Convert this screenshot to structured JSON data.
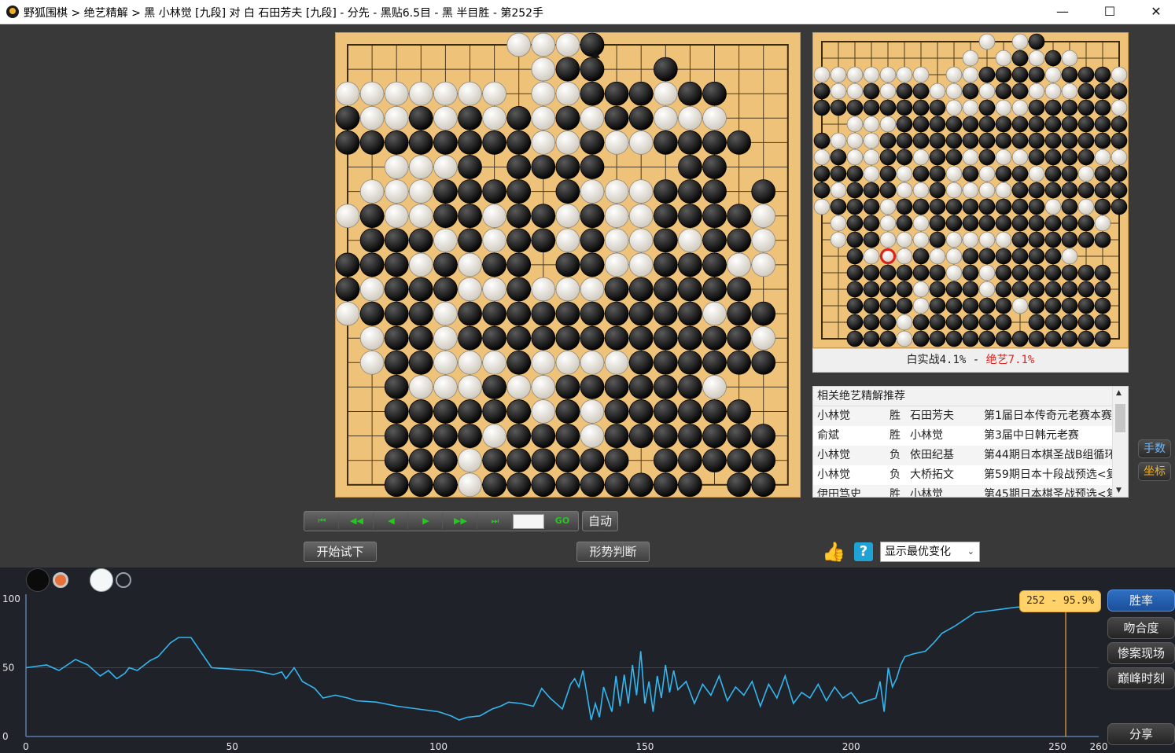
{
  "window": {
    "title": "野狐围棋 > 绝艺精解 > 黑 小林觉 [九段] 对 白 石田芳夫 [九段] - 分先 - 黑贴6.5目 - 黑 半目胜 - 第252手",
    "minimize": "—",
    "maximize": "☐",
    "close": "✕"
  },
  "board": {
    "size": 19,
    "rows": [
      ".......wwwb........",
      "........wbb..b.....",
      "wwwwwww.wwbbbwbb...",
      "bwwbwbwbwbwbbwww...",
      "bbbbbbbbwwbwwbbbb..",
      "..wwwb.bbbb...bb...",
      ".wwwbbbb.bwwwbbb.b.",
      "wbwwbbwbbwbwwbbbbw.",
      ".bbbwbwbbwbwwbwbbw.",
      "bbbwbwbb.bbwwbbbww.",
      "bwbbbwwbwwwbbbbbb..",
      "wbbbwbbbbbbbbbbwbb.",
      ".wbbwbbbbbbbbbbbbw.",
      ".wbbwwwbwwwwbbbbbb.",
      "..bwwwbwwbbbbbbw...",
      "..bbbbbbwbwbbbbbb..",
      "..bbbbwbbbwbbbbbbb.",
      "..bbbwbbbbbb.bbbbb.",
      "..bbbwbbbbbbbbb.bb."
    ],
    "last_move_marker": "▲"
  },
  "mini_board": {
    "rows": [
      "..........w.wb.....",
      ".........w.wbwbw...",
      "wwwwwww.wwbbbbwbbbw",
      "bwwbwbbwwbwbbwwwbbb",
      "bbbbbbbbwwbwwbbbbbw",
      "..wwwbbbbbbbbbbbbbb",
      "bwwwbbbbbbbbbbbbbbb",
      "wbwwbbwbbwbwwbbbbww",
      "bbbwbwbbwbwbbwbbwbb",
      "bwbbbwwbwwwwbbbbbbb",
      "wbbbwbbbbbbbbbwbwbb",
      ".wbbwbwbbbbbbbbbbw.",
      ".wbbwwwbwwwwbbbbbb.",
      "..bwwwbwwbbbbbbw...",
      "..bbbbbbwbwbbbbbbb.",
      "..bbbbwbbbwbbbbbbb.",
      "..bbbbwbbbbbwbbbbb.",
      "..bbbwbbbbbb.bbbbb.",
      "..bbbwbbbbbbbbbbbb."
    ],
    "marker": {
      "col": 4,
      "row": 13
    }
  },
  "winrate_compare": {
    "part1": "白实战4.1% - ",
    "part2": "绝艺7.1%"
  },
  "recommend": {
    "title": "相关绝艺精解推荐",
    "rows": [
      [
        "小林觉",
        "胜",
        "石田芳夫",
        "第1届日本传奇元老赛本赛"
      ],
      [
        "俞斌",
        "胜",
        "小林觉",
        "第3届中日韩元老赛"
      ],
      [
        "小林觉",
        "负",
        "依田纪基",
        "第44期日本棋圣战B组循环"
      ],
      [
        "小林觉",
        "负",
        "大桥拓文",
        "第59期日本十段战预选<复"
      ],
      [
        "伊田笃史",
        "胜",
        "小林觉",
        "第45期日本棋圣战预选<复"
      ]
    ]
  },
  "side_buttons": {
    "moves": "手数",
    "coords": "坐标"
  },
  "nav": {
    "first": "⏮",
    "back10": "◀◀",
    "back": "◀",
    "forward": "▶",
    "forward10": "▶▶",
    "last": "⏭",
    "go": "GO",
    "move_input": "",
    "auto": "自动",
    "try": "开始试下",
    "judge": "形势判断",
    "thumb": "👍",
    "help": "?",
    "variation": "显示最优变化",
    "chevron": "⌄"
  },
  "chart": {
    "tooltip": "252 - 95.9%",
    "buttons": [
      "胜率",
      "吻合度",
      "惨案现场",
      "巅峰时刻",
      "分享"
    ],
    "colors": {
      "line": "#34b6f0",
      "cursor": "#f3a43a",
      "bg": "#1f2329"
    }
  },
  "chart_data": {
    "type": "line",
    "xlim": [
      0,
      260
    ],
    "ylim": [
      0,
      100
    ],
    "xticks": [
      0,
      50,
      100,
      150,
      200,
      250,
      260
    ],
    "yticks": [
      0,
      50,
      100
    ],
    "cursor_x": 252,
    "x": [
      0,
      5,
      8,
      12,
      15,
      18,
      20,
      22,
      24,
      25,
      27,
      30,
      32,
      35,
      37,
      40,
      45,
      50,
      55,
      57,
      60,
      62,
      63,
      65,
      67,
      70,
      72,
      75,
      78,
      80,
      85,
      90,
      95,
      100,
      103,
      105,
      107,
      110,
      113,
      115,
      117,
      120,
      123,
      125,
      127,
      130,
      132,
      133,
      134,
      135,
      136,
      137,
      138,
      139,
      140,
      142,
      143,
      144,
      145,
      146,
      147,
      148,
      149,
      150,
      151,
      152,
      153,
      154,
      155,
      156,
      157,
      158,
      160,
      162,
      164,
      166,
      168,
      170,
      172,
      174,
      176,
      178,
      180,
      182,
      184,
      186,
      188,
      190,
      192,
      194,
      196,
      198,
      200,
      202,
      204,
      206,
      207,
      208,
      209,
      210,
      211,
      212,
      213,
      215,
      218,
      220,
      222,
      225,
      228,
      230,
      235,
      240,
      245,
      250,
      252
    ],
    "y": [
      50,
      52,
      48,
      56,
      52,
      44,
      48,
      42,
      46,
      50,
      48,
      55,
      58,
      68,
      72,
      72,
      50,
      49,
      48,
      47,
      45,
      47,
      42,
      50,
      40,
      35,
      28,
      30,
      28,
      26,
      25,
      22,
      20,
      18,
      15,
      12,
      14,
      15,
      20,
      22,
      25,
      24,
      22,
      35,
      28,
      20,
      38,
      42,
      36,
      48,
      30,
      12,
      24,
      14,
      36,
      18,
      44,
      22,
      45,
      24,
      52,
      30,
      62,
      24,
      40,
      18,
      44,
      28,
      52,
      32,
      48,
      34,
      40,
      24,
      38,
      30,
      44,
      26,
      36,
      30,
      40,
      22,
      38,
      28,
      44,
      24,
      32,
      28,
      38,
      26,
      36,
      28,
      32,
      24,
      26,
      28,
      40,
      18,
      50,
      36,
      42,
      52,
      58,
      60,
      62,
      68,
      75,
      80,
      86,
      90,
      92,
      94,
      95,
      95.5,
      95.9
    ]
  }
}
